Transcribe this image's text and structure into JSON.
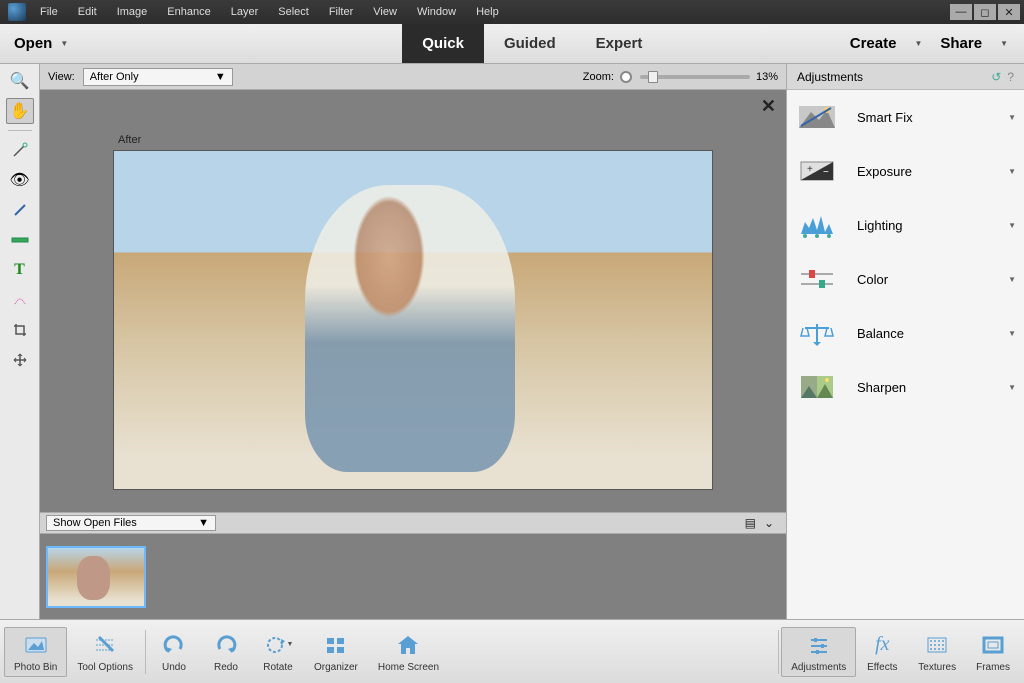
{
  "menu": [
    "File",
    "Edit",
    "Image",
    "Enhance",
    "Layer",
    "Select",
    "Filter",
    "View",
    "Window",
    "Help"
  ],
  "toolbar": {
    "open": "Open",
    "modes": [
      "Quick",
      "Guided",
      "Expert"
    ],
    "active_mode": "Quick",
    "create": "Create",
    "share": "Share"
  },
  "viewbar": {
    "label": "View:",
    "selected": "After Only",
    "zoom_label": "Zoom:",
    "zoom_value": "13%"
  },
  "canvas": {
    "label": "After",
    "close": "✕"
  },
  "photobin": {
    "selected": "Show Open Files"
  },
  "panel": {
    "title": "Adjustments",
    "items": [
      "Smart Fix",
      "Exposure",
      "Lighting",
      "Color",
      "Balance",
      "Sharpen"
    ]
  },
  "footer_left": [
    "Photo Bin",
    "Tool Options",
    "Undo",
    "Redo",
    "Rotate",
    "Organizer",
    "Home Screen"
  ],
  "footer_right": [
    "Adjustments",
    "Effects",
    "Textures",
    "Frames"
  ]
}
